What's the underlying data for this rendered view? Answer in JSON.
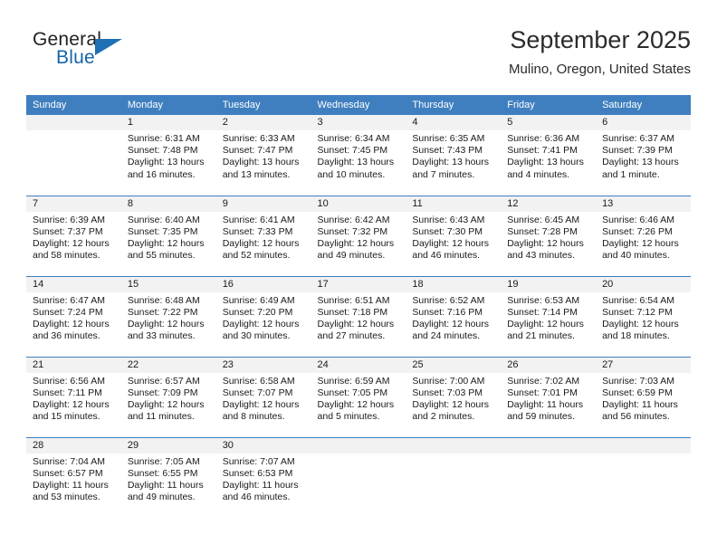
{
  "brand": {
    "name_part1": "General",
    "name_part2": "Blue",
    "triangle_color": "#1f6fb5"
  },
  "header": {
    "title": "September 2025",
    "location": "Mulino, Oregon, United States"
  },
  "theme": {
    "header_row_bg": "#3f7fbf",
    "day_number_bg": "#f2f2f2",
    "grid_line": "#3f7fbf",
    "text": "#1a1a1a"
  },
  "weekday_headers": [
    "Sunday",
    "Monday",
    "Tuesday",
    "Wednesday",
    "Thursday",
    "Friday",
    "Saturday"
  ],
  "weeks": [
    [
      {
        "day": "",
        "sunrise": "",
        "sunset": "",
        "daylight1": "",
        "daylight2": ""
      },
      {
        "day": "1",
        "sunrise": "Sunrise: 6:31 AM",
        "sunset": "Sunset: 7:48 PM",
        "daylight1": "Daylight: 13 hours",
        "daylight2": "and 16 minutes."
      },
      {
        "day": "2",
        "sunrise": "Sunrise: 6:33 AM",
        "sunset": "Sunset: 7:47 PM",
        "daylight1": "Daylight: 13 hours",
        "daylight2": "and 13 minutes."
      },
      {
        "day": "3",
        "sunrise": "Sunrise: 6:34 AM",
        "sunset": "Sunset: 7:45 PM",
        "daylight1": "Daylight: 13 hours",
        "daylight2": "and 10 minutes."
      },
      {
        "day": "4",
        "sunrise": "Sunrise: 6:35 AM",
        "sunset": "Sunset: 7:43 PM",
        "daylight1": "Daylight: 13 hours",
        "daylight2": "and 7 minutes."
      },
      {
        "day": "5",
        "sunrise": "Sunrise: 6:36 AM",
        "sunset": "Sunset: 7:41 PM",
        "daylight1": "Daylight: 13 hours",
        "daylight2": "and 4 minutes."
      },
      {
        "day": "6",
        "sunrise": "Sunrise: 6:37 AM",
        "sunset": "Sunset: 7:39 PM",
        "daylight1": "Daylight: 13 hours",
        "daylight2": "and 1 minute."
      }
    ],
    [
      {
        "day": "7",
        "sunrise": "Sunrise: 6:39 AM",
        "sunset": "Sunset: 7:37 PM",
        "daylight1": "Daylight: 12 hours",
        "daylight2": "and 58 minutes."
      },
      {
        "day": "8",
        "sunrise": "Sunrise: 6:40 AM",
        "sunset": "Sunset: 7:35 PM",
        "daylight1": "Daylight: 12 hours",
        "daylight2": "and 55 minutes."
      },
      {
        "day": "9",
        "sunrise": "Sunrise: 6:41 AM",
        "sunset": "Sunset: 7:33 PM",
        "daylight1": "Daylight: 12 hours",
        "daylight2": "and 52 minutes."
      },
      {
        "day": "10",
        "sunrise": "Sunrise: 6:42 AM",
        "sunset": "Sunset: 7:32 PM",
        "daylight1": "Daylight: 12 hours",
        "daylight2": "and 49 minutes."
      },
      {
        "day": "11",
        "sunrise": "Sunrise: 6:43 AM",
        "sunset": "Sunset: 7:30 PM",
        "daylight1": "Daylight: 12 hours",
        "daylight2": "and 46 minutes."
      },
      {
        "day": "12",
        "sunrise": "Sunrise: 6:45 AM",
        "sunset": "Sunset: 7:28 PM",
        "daylight1": "Daylight: 12 hours",
        "daylight2": "and 43 minutes."
      },
      {
        "day": "13",
        "sunrise": "Sunrise: 6:46 AM",
        "sunset": "Sunset: 7:26 PM",
        "daylight1": "Daylight: 12 hours",
        "daylight2": "and 40 minutes."
      }
    ],
    [
      {
        "day": "14",
        "sunrise": "Sunrise: 6:47 AM",
        "sunset": "Sunset: 7:24 PM",
        "daylight1": "Daylight: 12 hours",
        "daylight2": "and 36 minutes."
      },
      {
        "day": "15",
        "sunrise": "Sunrise: 6:48 AM",
        "sunset": "Sunset: 7:22 PM",
        "daylight1": "Daylight: 12 hours",
        "daylight2": "and 33 minutes."
      },
      {
        "day": "16",
        "sunrise": "Sunrise: 6:49 AM",
        "sunset": "Sunset: 7:20 PM",
        "daylight1": "Daylight: 12 hours",
        "daylight2": "and 30 minutes."
      },
      {
        "day": "17",
        "sunrise": "Sunrise: 6:51 AM",
        "sunset": "Sunset: 7:18 PM",
        "daylight1": "Daylight: 12 hours",
        "daylight2": "and 27 minutes."
      },
      {
        "day": "18",
        "sunrise": "Sunrise: 6:52 AM",
        "sunset": "Sunset: 7:16 PM",
        "daylight1": "Daylight: 12 hours",
        "daylight2": "and 24 minutes."
      },
      {
        "day": "19",
        "sunrise": "Sunrise: 6:53 AM",
        "sunset": "Sunset: 7:14 PM",
        "daylight1": "Daylight: 12 hours",
        "daylight2": "and 21 minutes."
      },
      {
        "day": "20",
        "sunrise": "Sunrise: 6:54 AM",
        "sunset": "Sunset: 7:12 PM",
        "daylight1": "Daylight: 12 hours",
        "daylight2": "and 18 minutes."
      }
    ],
    [
      {
        "day": "21",
        "sunrise": "Sunrise: 6:56 AM",
        "sunset": "Sunset: 7:11 PM",
        "daylight1": "Daylight: 12 hours",
        "daylight2": "and 15 minutes."
      },
      {
        "day": "22",
        "sunrise": "Sunrise: 6:57 AM",
        "sunset": "Sunset: 7:09 PM",
        "daylight1": "Daylight: 12 hours",
        "daylight2": "and 11 minutes."
      },
      {
        "day": "23",
        "sunrise": "Sunrise: 6:58 AM",
        "sunset": "Sunset: 7:07 PM",
        "daylight1": "Daylight: 12 hours",
        "daylight2": "and 8 minutes."
      },
      {
        "day": "24",
        "sunrise": "Sunrise: 6:59 AM",
        "sunset": "Sunset: 7:05 PM",
        "daylight1": "Daylight: 12 hours",
        "daylight2": "and 5 minutes."
      },
      {
        "day": "25",
        "sunrise": "Sunrise: 7:00 AM",
        "sunset": "Sunset: 7:03 PM",
        "daylight1": "Daylight: 12 hours",
        "daylight2": "and 2 minutes."
      },
      {
        "day": "26",
        "sunrise": "Sunrise: 7:02 AM",
        "sunset": "Sunset: 7:01 PM",
        "daylight1": "Daylight: 11 hours",
        "daylight2": "and 59 minutes."
      },
      {
        "day": "27",
        "sunrise": "Sunrise: 7:03 AM",
        "sunset": "Sunset: 6:59 PM",
        "daylight1": "Daylight: 11 hours",
        "daylight2": "and 56 minutes."
      }
    ],
    [
      {
        "day": "28",
        "sunrise": "Sunrise: 7:04 AM",
        "sunset": "Sunset: 6:57 PM",
        "daylight1": "Daylight: 11 hours",
        "daylight2": "and 53 minutes."
      },
      {
        "day": "29",
        "sunrise": "Sunrise: 7:05 AM",
        "sunset": "Sunset: 6:55 PM",
        "daylight1": "Daylight: 11 hours",
        "daylight2": "and 49 minutes."
      },
      {
        "day": "30",
        "sunrise": "Sunrise: 7:07 AM",
        "sunset": "Sunset: 6:53 PM",
        "daylight1": "Daylight: 11 hours",
        "daylight2": "and 46 minutes."
      },
      {
        "day": "",
        "sunrise": "",
        "sunset": "",
        "daylight1": "",
        "daylight2": ""
      },
      {
        "day": "",
        "sunrise": "",
        "sunset": "",
        "daylight1": "",
        "daylight2": ""
      },
      {
        "day": "",
        "sunrise": "",
        "sunset": "",
        "daylight1": "",
        "daylight2": ""
      },
      {
        "day": "",
        "sunrise": "",
        "sunset": "",
        "daylight1": "",
        "daylight2": ""
      }
    ]
  ]
}
